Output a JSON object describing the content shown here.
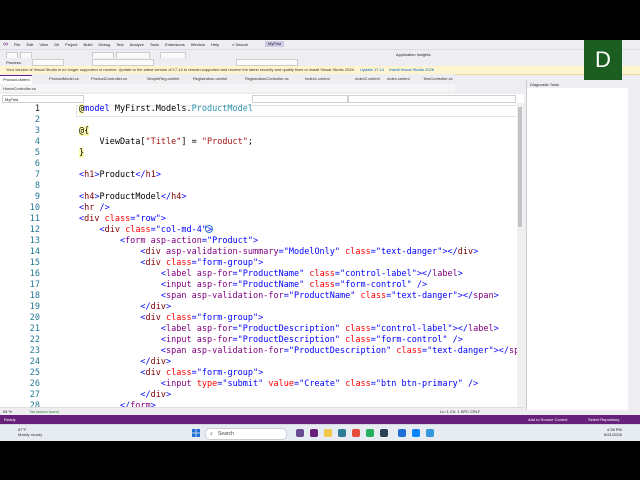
{
  "menu": {
    "items": [
      "File",
      "Edit",
      "View",
      "Git",
      "Project",
      "Build",
      "Debug",
      "Test",
      "Analyze",
      "Tools",
      "Extensions",
      "Window",
      "Help"
    ],
    "search_label": "Search",
    "solution_name": "MyFirst"
  },
  "toolbar": {
    "process_label": "Process:",
    "app_insights": "Application Insights"
  },
  "infobar": {
    "message": "Your version of Visual Studio is no longer supported or receive. Update to the latest version of 17.14 to remain supported and receive the latest security and quality fixes or install Visual Studio 2026.",
    "update_link": "Update 17.14",
    "install_link": "Install Visual Studio 2026"
  },
  "tabs": [
    {
      "label": "Product.cshtml",
      "active": true
    },
    {
      "label": "ProductModel.cs"
    },
    {
      "label": "ProductController.cs"
    },
    {
      "label": "SimpleReg.cshtml"
    },
    {
      "label": "Registration.cshtml"
    },
    {
      "label": "RegistrationController.cs"
    },
    {
      "label": "Index1.cshtml"
    },
    {
      "label": "Index2.cshtml"
    },
    {
      "label": "Index.cshtml"
    },
    {
      "label": "TestController.cs"
    }
  ],
  "subtab": "HomeController.cs",
  "nav": {
    "project": "MyFirst"
  },
  "editor": {
    "current_line": 1,
    "lines": [
      {
        "n": "1",
        "tokens": [
          [
            "@",
            "dir"
          ],
          [
            "model",
            "kw"
          ],
          [
            " MyFirst.Models.",
            "text"
          ],
          [
            "ProductModel",
            "type"
          ]
        ]
      },
      {
        "n": "2",
        "tokens": []
      },
      {
        "n": "3",
        "tokens": [
          [
            "@{",
            "dir"
          ]
        ]
      },
      {
        "n": "4",
        "tokens": [
          [
            "    ViewData[",
            "text"
          ],
          [
            "\"Title\"",
            "cs"
          ],
          [
            "] = ",
            "text"
          ],
          [
            "\"Product\"",
            "cs"
          ],
          [
            ";",
            "text"
          ]
        ]
      },
      {
        "n": "5",
        "tokens": [
          [
            "}",
            "dir"
          ]
        ]
      },
      {
        "n": "6",
        "tokens": []
      },
      {
        "n": "7",
        "tokens": [
          [
            "<",
            "kw"
          ],
          [
            "h1",
            "tag"
          ],
          [
            ">",
            "kw"
          ],
          [
            "Product",
            "text"
          ],
          [
            "</",
            "kw"
          ],
          [
            "h1",
            "tag"
          ],
          [
            ">",
            "kw"
          ]
        ]
      },
      {
        "n": "8",
        "tokens": []
      },
      {
        "n": "9",
        "tokens": [
          [
            "<",
            "kw"
          ],
          [
            "h4",
            "tag"
          ],
          [
            ">",
            "kw"
          ],
          [
            "ProductModel",
            "text"
          ],
          [
            "</",
            "kw"
          ],
          [
            "h4",
            "tag"
          ],
          [
            ">",
            "kw"
          ]
        ]
      },
      {
        "n": "10",
        "tokens": [
          [
            "<",
            "kw"
          ],
          [
            "hr",
            "tag"
          ],
          [
            " />",
            "kw"
          ]
        ]
      },
      {
        "n": "11",
        "tokens": [
          [
            "<",
            "kw"
          ],
          [
            "div",
            "tag"
          ],
          [
            " ",
            "text"
          ],
          [
            "class",
            "attr"
          ],
          [
            "=",
            "kw"
          ],
          [
            "\"row\"",
            "str"
          ],
          [
            ">",
            "kw"
          ]
        ]
      },
      {
        "n": "12",
        "tokens": [
          [
            "    <",
            "kw"
          ],
          [
            "div",
            "tag"
          ],
          [
            " ",
            "text"
          ],
          [
            "class",
            "attr"
          ],
          [
            "=",
            "kw"
          ],
          [
            "\"col-md-4\"",
            "str"
          ],
          [
            ">",
            "kw"
          ]
        ]
      },
      {
        "n": "13",
        "tokens": [
          [
            "        <",
            "kw"
          ],
          [
            "form",
            "tha"
          ],
          [
            " ",
            "text"
          ],
          [
            "asp-action",
            "tha"
          ],
          [
            "=",
            "kw"
          ],
          [
            "\"Product\"",
            "str"
          ],
          [
            ">",
            "kw"
          ]
        ]
      },
      {
        "n": "14",
        "tokens": [
          [
            "            <",
            "kw"
          ],
          [
            "div",
            "tag"
          ],
          [
            " ",
            "text"
          ],
          [
            "asp-validation-summary",
            "tha"
          ],
          [
            "=",
            "kw"
          ],
          [
            "\"ModelOnly\"",
            "str"
          ],
          [
            " ",
            "text"
          ],
          [
            "class",
            "attr"
          ],
          [
            "=",
            "kw"
          ],
          [
            "\"text-danger\"",
            "str"
          ],
          [
            "></",
            "kw"
          ],
          [
            "div",
            "tag"
          ],
          [
            ">",
            "kw"
          ]
        ]
      },
      {
        "n": "15",
        "tokens": [
          [
            "            <",
            "kw"
          ],
          [
            "div",
            "tag"
          ],
          [
            " ",
            "text"
          ],
          [
            "class",
            "attr"
          ],
          [
            "=",
            "kw"
          ],
          [
            "\"form-group\"",
            "str"
          ],
          [
            ">",
            "kw"
          ]
        ]
      },
      {
        "n": "16",
        "tokens": [
          [
            "                <",
            "kw"
          ],
          [
            "label",
            "tha"
          ],
          [
            " ",
            "text"
          ],
          [
            "asp-for",
            "tha"
          ],
          [
            "=",
            "kw"
          ],
          [
            "\"ProductName\"",
            "str"
          ],
          [
            " ",
            "text"
          ],
          [
            "class",
            "attr"
          ],
          [
            "=",
            "kw"
          ],
          [
            "\"control-label\"",
            "str"
          ],
          [
            "></",
            "kw"
          ],
          [
            "label",
            "tha"
          ],
          [
            ">",
            "kw"
          ]
        ]
      },
      {
        "n": "17",
        "tokens": [
          [
            "                <",
            "kw"
          ],
          [
            "input",
            "tha"
          ],
          [
            " ",
            "text"
          ],
          [
            "asp-for",
            "tha"
          ],
          [
            "=",
            "kw"
          ],
          [
            "\"ProductName\"",
            "str"
          ],
          [
            " ",
            "text"
          ],
          [
            "class",
            "attr"
          ],
          [
            "=",
            "kw"
          ],
          [
            "\"form-control\"",
            "str"
          ],
          [
            " />",
            "kw"
          ]
        ]
      },
      {
        "n": "18",
        "tokens": [
          [
            "                <",
            "kw"
          ],
          [
            "span",
            "tha"
          ],
          [
            " ",
            "text"
          ],
          [
            "asp-validation-for",
            "tha"
          ],
          [
            "=",
            "kw"
          ],
          [
            "\"ProductName\"",
            "str"
          ],
          [
            " ",
            "text"
          ],
          [
            "class",
            "attr"
          ],
          [
            "=",
            "kw"
          ],
          [
            "\"text-danger\"",
            "str"
          ],
          [
            "></",
            "kw"
          ],
          [
            "span",
            "tha"
          ],
          [
            ">",
            "kw"
          ]
        ]
      },
      {
        "n": "19",
        "tokens": [
          [
            "            </",
            "kw"
          ],
          [
            "div",
            "tag"
          ],
          [
            ">",
            "kw"
          ]
        ]
      },
      {
        "n": "20",
        "tokens": [
          [
            "            <",
            "kw"
          ],
          [
            "div",
            "tag"
          ],
          [
            " ",
            "text"
          ],
          [
            "class",
            "attr"
          ],
          [
            "=",
            "kw"
          ],
          [
            "\"form-group\"",
            "str"
          ],
          [
            ">",
            "kw"
          ]
        ]
      },
      {
        "n": "21",
        "tokens": [
          [
            "                <",
            "kw"
          ],
          [
            "label",
            "tha"
          ],
          [
            " ",
            "text"
          ],
          [
            "asp-for",
            "tha"
          ],
          [
            "=",
            "kw"
          ],
          [
            "\"ProductDescription\"",
            "str"
          ],
          [
            " ",
            "text"
          ],
          [
            "class",
            "attr"
          ],
          [
            "=",
            "kw"
          ],
          [
            "\"control-label\"",
            "str"
          ],
          [
            "></",
            "kw"
          ],
          [
            "label",
            "tha"
          ],
          [
            ">",
            "kw"
          ]
        ]
      },
      {
        "n": "22",
        "tokens": [
          [
            "                <",
            "kw"
          ],
          [
            "input",
            "tha"
          ],
          [
            " ",
            "text"
          ],
          [
            "asp-for",
            "tha"
          ],
          [
            "=",
            "kw"
          ],
          [
            "\"ProductDescription\"",
            "str"
          ],
          [
            " ",
            "text"
          ],
          [
            "class",
            "attr"
          ],
          [
            "=",
            "kw"
          ],
          [
            "\"form-control\"",
            "str"
          ],
          [
            " />",
            "kw"
          ]
        ]
      },
      {
        "n": "23",
        "tokens": [
          [
            "                <",
            "kw"
          ],
          [
            "span",
            "tha"
          ],
          [
            " ",
            "text"
          ],
          [
            "asp-validation-for",
            "tha"
          ],
          [
            "=",
            "kw"
          ],
          [
            "\"ProductDescription\"",
            "str"
          ],
          [
            " ",
            "text"
          ],
          [
            "class",
            "attr"
          ],
          [
            "=",
            "kw"
          ],
          [
            "\"text-danger\"",
            "str"
          ],
          [
            "></",
            "kw"
          ],
          [
            "span",
            "tha"
          ],
          [
            ">",
            "kw"
          ]
        ]
      },
      {
        "n": "24",
        "tokens": [
          [
            "            </",
            "kw"
          ],
          [
            "div",
            "tag"
          ],
          [
            ">",
            "kw"
          ]
        ]
      },
      {
        "n": "25",
        "tokens": [
          [
            "            <",
            "kw"
          ],
          [
            "div",
            "tag"
          ],
          [
            " ",
            "text"
          ],
          [
            "class",
            "attr"
          ],
          [
            "=",
            "kw"
          ],
          [
            "\"form-group\"",
            "str"
          ],
          [
            ">",
            "kw"
          ]
        ]
      },
      {
        "n": "26",
        "tokens": [
          [
            "                <",
            "kw"
          ],
          [
            "input",
            "tha"
          ],
          [
            " ",
            "text"
          ],
          [
            "type",
            "attr"
          ],
          [
            "=",
            "kw"
          ],
          [
            "\"submit\"",
            "str"
          ],
          [
            " ",
            "text"
          ],
          [
            "value",
            "attr"
          ],
          [
            "=",
            "kw"
          ],
          [
            "\"Create\"",
            "str"
          ],
          [
            " ",
            "text"
          ],
          [
            "class",
            "attr"
          ],
          [
            "=",
            "kw"
          ],
          [
            "\"btn btn-primary\"",
            "str"
          ],
          [
            " />",
            "kw"
          ]
        ]
      },
      {
        "n": "27",
        "tokens": [
          [
            "            </",
            "kw"
          ],
          [
            "div",
            "tag"
          ],
          [
            ">",
            "kw"
          ]
        ]
      },
      {
        "n": "28",
        "tokens": [
          [
            "        </",
            "kw"
          ],
          [
            "form",
            "tha"
          ],
          [
            ">",
            "kw"
          ]
        ]
      }
    ]
  },
  "editor_status": {
    "zoom": "94 %",
    "issues": "No issues found",
    "position": "Ln: 1   Ch: 1   SPC   CRLF"
  },
  "diagnostic_tools": {
    "title": "Diagnostic Tools"
  },
  "statusbar": {
    "left": "Ready",
    "add_source": "Add to Source Control",
    "select_repo": "Select Repository"
  },
  "presenter_initial": "D",
  "taskbar": {
    "weather_temp": "87°F",
    "weather_desc": "Mostly cloudy",
    "search_placeholder": "Search",
    "time": "4:38 PM",
    "date": "6/21/2026"
  },
  "colors": {
    "accent": "#68217a",
    "avatar_bg": "#1b5e20"
  }
}
